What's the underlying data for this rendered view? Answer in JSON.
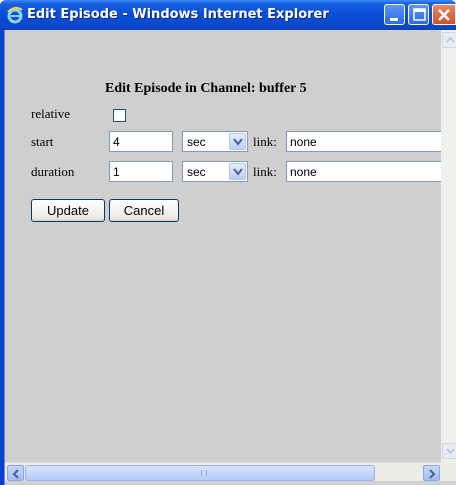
{
  "window": {
    "title": "Edit Episode - Windows Internet Explorer"
  },
  "form": {
    "heading": "Edit Episode in Channel: buffer 5",
    "relative_label": "relative",
    "relative_checked": false,
    "start_label": "start",
    "start_value": "4",
    "start_unit": "sec",
    "start_link_label": "link:",
    "start_link_value": "none",
    "duration_label": "duration",
    "duration_value": "1",
    "duration_unit": "sec",
    "duration_link_label": "link:",
    "duration_link_value": "none",
    "update_label": "Update",
    "cancel_label": "Cancel"
  },
  "icons": {
    "app": "ie-icon",
    "minimize": "minimize-icon",
    "maximize": "maximize-icon",
    "close": "close-icon",
    "dropdown": "chevron-down-icon"
  },
  "colors": {
    "titlebar": "#0b4fd8",
    "content_bg": "#cfcfcf",
    "close_button": "#d0502a"
  }
}
